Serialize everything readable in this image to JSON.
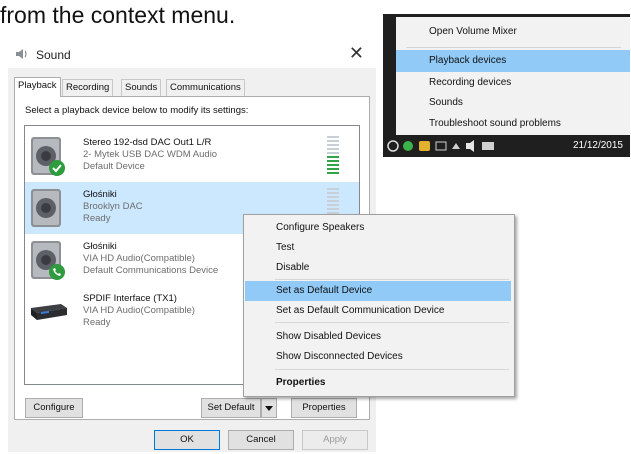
{
  "caption": "from the context menu.",
  "dialog": {
    "title": "Sound",
    "close_glyph": "✕",
    "tabs": [
      "Playback",
      "Recording",
      "Sounds",
      "Communications"
    ],
    "instructions": "Select a playback device below to modify its settings:",
    "devices": [
      {
        "name": "Stereo 192-dsd DAC Out1 L/R",
        "line1": "2- Mytek USB DAC WDM Audio",
        "line2": "Default Device",
        "icon": "speaker-icon",
        "badge": "green-check-icon",
        "level": 0.45
      },
      {
        "name": "Głośniki",
        "line1": "Brooklyn DAC",
        "line2": "Ready",
        "icon": "speaker-icon",
        "badge": "",
        "level": 0
      },
      {
        "name": "Głośniki",
        "line1": "VIA HD Audio(Compatible)",
        "line2": "Default Communications Device",
        "icon": "speaker-icon",
        "badge": "green-phone-icon",
        "level": 0
      },
      {
        "name": "SPDIF Interface (TX1)",
        "line1": "VIA HD Audio(Compatible)",
        "line2": "Ready",
        "icon": "spdif-device-icon",
        "badge": "",
        "level": 0
      }
    ],
    "buttons": {
      "configure": "Configure",
      "set_default": "Set Default",
      "properties": "Properties",
      "ok": "OK",
      "cancel": "Cancel",
      "apply": "Apply"
    }
  },
  "context_menu": {
    "items": [
      "Configure Speakers",
      "Test",
      "Disable",
      "Set as Default Device",
      "Set as Default Communication Device",
      "Show Disabled Devices",
      "Show Disconnected Devices",
      "Properties"
    ],
    "highlighted": "Set as Default Device"
  },
  "taskbar_menu": {
    "items": [
      "Open Volume Mixer",
      "Playback devices",
      "Recording devices",
      "Sounds",
      "Troubleshoot sound problems"
    ],
    "highlighted": "Playback devices",
    "date": "21/12/2015"
  },
  "colors": {
    "highlight": "#91c9f7",
    "selection": "#cce8ff",
    "meter_green": "#33a34a",
    "taskbar": "#1f1f1f"
  }
}
